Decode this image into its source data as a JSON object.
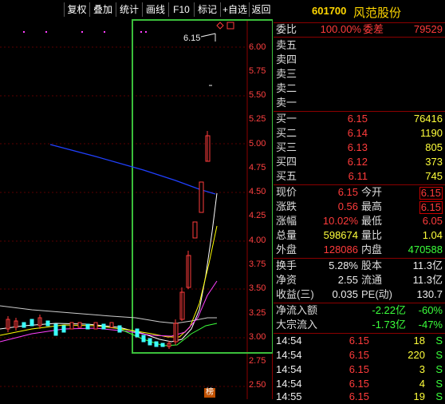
{
  "toolbar": {
    "buttons": [
      "复权",
      "叠加",
      "统计",
      "画线",
      "F10",
      "标记",
      "+自选",
      "返回"
    ]
  },
  "chart": {
    "price_label": "6.15",
    "bottom_tag": "榜",
    "y_ticks": [
      "6.00",
      "5.75",
      "5.50",
      "5.25",
      "5.00",
      "4.75",
      "4.50",
      "4.25",
      "4.00",
      "3.75",
      "3.50",
      "3.25",
      "3.00",
      "2.75",
      "2.50"
    ],
    "colors": {
      "up": "#ff3b3b",
      "down": "#3bffff",
      "ma5": "#ffffff",
      "ma10": "#ffff00",
      "ma20": "#ff40ff",
      "ma60": "#3bff3b",
      "trend": "#2040ff",
      "highlight": "#3bbf3b"
    }
  },
  "quote": {
    "code": "601700",
    "name": "风范股份",
    "weibi_label": "委比",
    "weibi_value": "100.00%",
    "weicha_label": "委差",
    "weicha_value": "79529",
    "sell": [
      {
        "label": "卖五"
      },
      {
        "label": "卖四"
      },
      {
        "label": "卖三"
      },
      {
        "label": "卖二"
      },
      {
        "label": "卖一"
      }
    ],
    "buy": [
      {
        "label": "买一",
        "price": "6.15",
        "vol": "76416"
      },
      {
        "label": "买二",
        "price": "6.14",
        "vol": "1190"
      },
      {
        "label": "买三",
        "price": "6.13",
        "vol": "805"
      },
      {
        "label": "买四",
        "price": "6.12",
        "vol": "373"
      },
      {
        "label": "买五",
        "price": "6.11",
        "vol": "745"
      }
    ],
    "stats": [
      {
        "l1": "现价",
        "v1": "6.15",
        "l2": "今开",
        "v2": "6.15"
      },
      {
        "l1": "涨跌",
        "v1": "0.56",
        "l2": "最高",
        "v2": "6.15"
      },
      {
        "l1": "涨幅",
        "v1": "10.02%",
        "l2": "最低",
        "v2": "6.05"
      },
      {
        "l1": "总量",
        "v1": "598674",
        "l2": "量比",
        "v2": "1.04"
      },
      {
        "l1": "外盘",
        "v1": "128086",
        "l2": "内盘",
        "v2": "470588"
      }
    ],
    "fund": [
      {
        "l1": "换手",
        "v1": "5.28%",
        "l2": "股本",
        "v2": "11.3亿"
      },
      {
        "l1": "净资",
        "v1": "2.55",
        "l2": "流通",
        "v2": "11.3亿"
      },
      {
        "l1": "收益(三)",
        "v1": "0.035",
        "l2": "PE(动)",
        "v2": "130.7"
      }
    ],
    "flow": [
      {
        "label": "净流入额",
        "value": "-2.22亿",
        "pct": "-60%"
      },
      {
        "label": "大宗流入",
        "value": "-1.73亿",
        "pct": "-47%"
      }
    ],
    "ticks": [
      {
        "time": "14:54",
        "price": "6.15",
        "vol": "18",
        "side": "S"
      },
      {
        "time": "14:54",
        "price": "6.15",
        "vol": "220",
        "side": "S"
      },
      {
        "time": "14:54",
        "price": "6.15",
        "vol": "3",
        "side": "S"
      },
      {
        "time": "14:54",
        "price": "6.15",
        "vol": "4",
        "side": "S"
      },
      {
        "time": "14:55",
        "price": "6.15",
        "vol": "19",
        "side": "S"
      }
    ]
  }
}
